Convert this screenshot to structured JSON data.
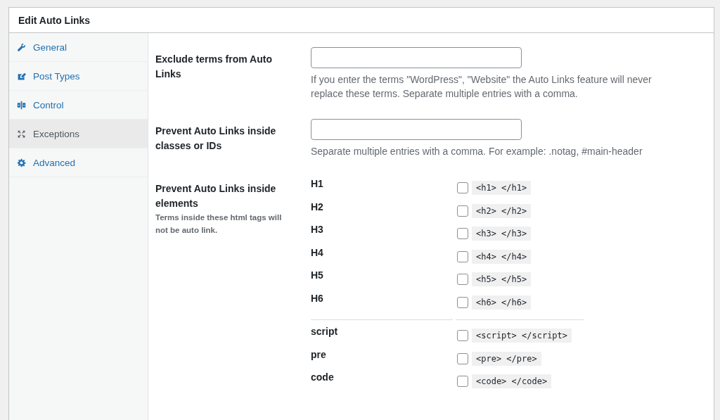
{
  "window": {
    "title": "Edit Auto Links"
  },
  "sidebar": {
    "items": [
      {
        "label": "General",
        "selected": false
      },
      {
        "label": "Post Types",
        "selected": false
      },
      {
        "label": "Control",
        "selected": false
      },
      {
        "label": "Exceptions",
        "selected": true
      },
      {
        "label": "Advanced",
        "selected": false
      }
    ]
  },
  "settings": [
    {
      "kind": "text",
      "label": "Exclude terms from Auto Links",
      "help": "If you enter the terms \"WordPress\", \"Website\" the Auto Links feature will never replace these terms. Separate multiple entries with a comma."
    },
    {
      "kind": "text",
      "label": "Prevent Auto Links inside classes or IDs",
      "help": "Separate multiple entries with a comma. For example: .notag, #main-header"
    },
    {
      "kind": "checks",
      "label": "Prevent Auto Links inside elements",
      "description": "Terms inside these html tags will not be auto link.",
      "groups": [
        [
          {
            "name": "H1",
            "tag": "<h1> </h1>",
            "checked": false
          },
          {
            "name": "H2",
            "tag": "<h2> </h2>",
            "checked": false
          },
          {
            "name": "H3",
            "tag": "<h3> </h3>",
            "checked": false
          },
          {
            "name": "H4",
            "tag": "<h4> </h4>",
            "checked": false
          },
          {
            "name": "H5",
            "tag": "<h5> </h5>",
            "checked": false
          },
          {
            "name": "H6",
            "tag": "<h6> </h6>",
            "checked": false
          }
        ],
        [
          {
            "name": "script",
            "tag": "<script> </script>",
            "checked": false
          },
          {
            "name": "pre",
            "tag": "<pre> </pre>",
            "checked": false
          },
          {
            "name": "code",
            "tag": "<code> </code>",
            "checked": false
          }
        ]
      ]
    }
  ]
}
